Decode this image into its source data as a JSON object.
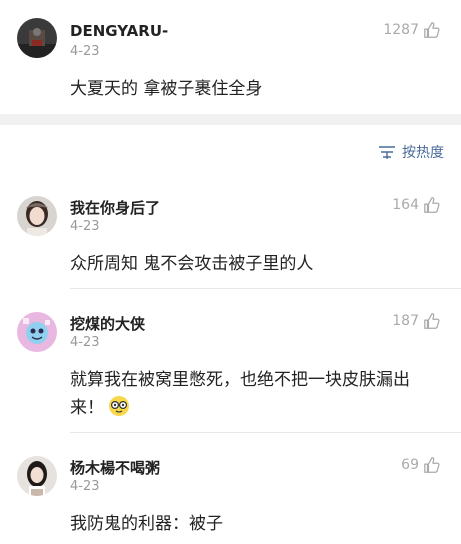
{
  "colors": {
    "accent_link": "#4a6a9a",
    "muted": "#999999",
    "band": "#f1f1f1"
  },
  "top_comment": {
    "username": "DENGYARU-",
    "date": "4-23",
    "likes": "1287",
    "content": "大夏天的 拿被子裹住全身",
    "avatar_icon": "dark-photo-avatar",
    "like_icon": "thumbs-up-icon"
  },
  "sort": {
    "label": "按热度",
    "icon": "sort-lines-icon"
  },
  "replies": [
    {
      "username": "我在你身后了",
      "date": "4-23",
      "likes": "164",
      "content": "众所周知 鬼不会攻击被子里的人",
      "avatar_icon": "girl-photo-avatar"
    },
    {
      "username": "挖煤的大侠",
      "date": "4-23",
      "likes": "187",
      "content": "就算我在被窝里憋死，也绝不把一块皮肤漏出来！",
      "avatar_icon": "cartoon-avatar",
      "trailing_emoji": "nerd-face-emoji"
    },
    {
      "username": "杨木楊不喝粥",
      "date": "4-23",
      "likes": "69",
      "content": "我防鬼的利器：被子",
      "avatar_icon": "girl-photo-avatar"
    }
  ]
}
